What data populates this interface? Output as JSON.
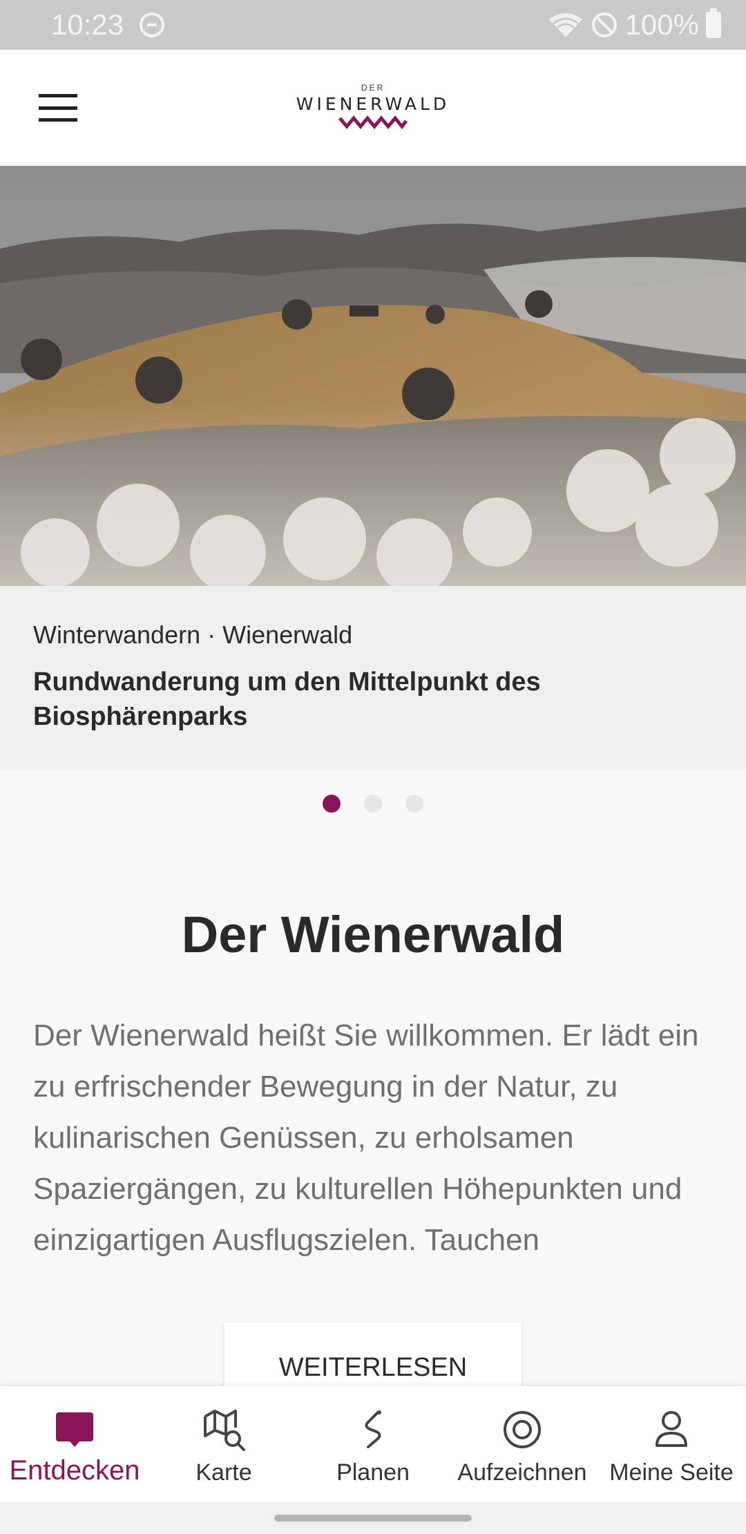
{
  "status_bar": {
    "time": "10:23",
    "battery": "100%"
  },
  "header": {
    "logo_small": "DER",
    "logo_main": "WIENERWALD",
    "logo_wave": "wave-logo-mark"
  },
  "hero": {
    "image": "misty-hills-landscape",
    "kicker": "Winterwandern · Wienerwald",
    "title": "Rundwanderung um den Mittelpunkt des Biosphärenparks",
    "slide_count": 3,
    "active_slide": 1
  },
  "intro": {
    "title": "Der Wienerwald",
    "text": "Der Wienerwald heißt Sie willkommen. Er lädt ein zu erfrischender Bewegung in der Natur, zu kulinarischen Genüssen, zu erholsamen Spaziergängen, zu kulturellen Höhepunkten und einzigartigen Ausflugszielen. Tauchen",
    "button_label": "WEITERLESEN"
  },
  "bottom_nav": {
    "items": [
      {
        "label": "Entdecken",
        "icon": "bookmark-icon",
        "active": true
      },
      {
        "label": "Karte",
        "icon": "map-search-icon",
        "active": false
      },
      {
        "label": "Planen",
        "icon": "route-icon",
        "active": false
      },
      {
        "label": "Aufzeichnen",
        "icon": "record-icon",
        "active": false
      },
      {
        "label": "Meine Seite",
        "icon": "user-icon",
        "active": false
      }
    ]
  },
  "colors": {
    "accent": "#8a1458",
    "text": "#2a2a2a",
    "muted_text": "#6f6f6f",
    "background": "#f8f8f8"
  }
}
